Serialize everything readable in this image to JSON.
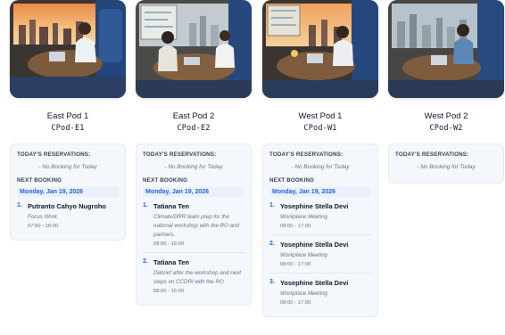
{
  "labels": {
    "todays_reservations": "TODAY'S RESERVATIONS:",
    "no_booking": "- No Booking for Today",
    "next_booking": "NEXT BOOKING"
  },
  "pods": [
    {
      "name": "East Pod 1",
      "code": "CPod-E1",
      "next_date": "Monday, Jan 19, 2026",
      "bookings": [
        {
          "num": "1.",
          "name": "Putranto Cahyo Nugroho",
          "desc": "Focus Work",
          "time": "07:00 - 16:00"
        }
      ]
    },
    {
      "name": "East Pod 2",
      "code": "CPod-E2",
      "next_date": "Monday, Jan 19, 2026",
      "bookings": [
        {
          "num": "1.",
          "name": "Tatiana Ten",
          "desc": "Climate/DRR team prep for the national workshop with the RO and partners.",
          "time": "08:00 - 16:00"
        },
        {
          "num": "2.",
          "name": "Tatiana Ten",
          "desc": "Debrief after the workshop and next steps on CCDRI with the RO",
          "time": "08:00 - 16:00"
        }
      ]
    },
    {
      "name": "West Pod 1",
      "code": "CPod-W1",
      "next_date": "Monday, Jan 19, 2026",
      "bookings": [
        {
          "num": "1.",
          "name": "Yosephine Stella Devi",
          "desc": "Workplace Meeting",
          "time": "08:00 - 17:00"
        },
        {
          "num": "2.",
          "name": "Yosephine Stella Devi",
          "desc": "Workplace Meeting",
          "time": "08:00 - 17:00"
        },
        {
          "num": "3.",
          "name": "Yosephine Stella Devi",
          "desc": "Workplace Meeting",
          "time": "08:00 - 17:00"
        }
      ]
    },
    {
      "name": "West Pod 2",
      "code": "CPod-W2",
      "next_date": null,
      "bookings": []
    }
  ],
  "colors": {
    "accent": "#2563eb",
    "card_bg": "#f4f7fb",
    "sky_sunset": "#f2a25c",
    "sky_day": "#b9c6cf",
    "booth_blue": "#2b4f86"
  }
}
